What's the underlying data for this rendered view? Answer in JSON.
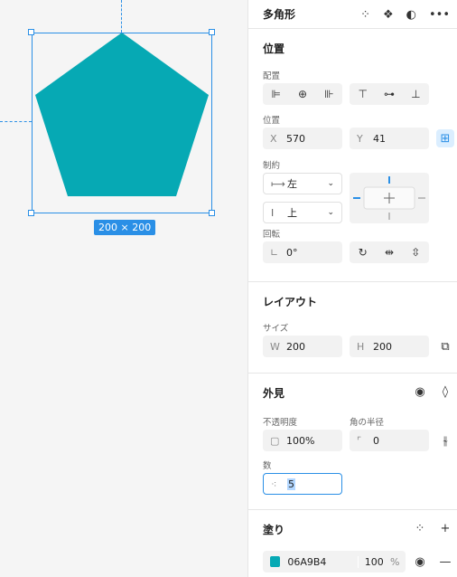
{
  "canvas": {
    "size_label": "200 × 200",
    "shape_fill": "#06A9B4",
    "selection_color": "#2A8FE6"
  },
  "panel": {
    "title": "多角形",
    "header_icons": [
      "component-grid-icon",
      "component-diamond-icon",
      "mask-icon",
      "more-icon"
    ],
    "position": {
      "title": "位置",
      "align_label": "配置",
      "pos_label": "位置",
      "x_prefix": "X",
      "x": "570",
      "y_prefix": "Y",
      "y": "41",
      "constraints_label": "制約",
      "h_constraint": "左",
      "v_constraint": "上",
      "rotation_label": "回転",
      "rotation": "0°"
    },
    "layout": {
      "title": "レイアウト",
      "size_label": "サイズ",
      "w_prefix": "W",
      "w": "200",
      "h_prefix": "H",
      "h": "200"
    },
    "appearance": {
      "title": "外見",
      "opacity_label": "不透明度",
      "radius_label": "角の半径",
      "opacity": "100%",
      "radius": "0",
      "count_label": "数",
      "count": "5"
    },
    "fill": {
      "title": "塗り",
      "hex": "06A9B4",
      "opacity": "100",
      "unit": "%",
      "color": "#06A9B4"
    }
  }
}
